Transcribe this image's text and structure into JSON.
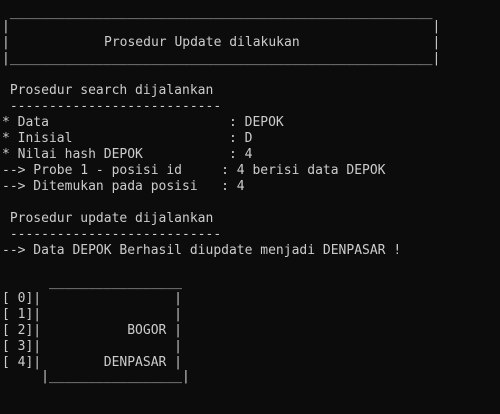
{
  "colors": {
    "background": "#0c0c0c",
    "text": "#cccccc"
  },
  "banner": {
    "top_border": " ______________________________________________________",
    "side_line": "|                                                      |",
    "title": "Prosedur Update dilakukan",
    "bottom_border": "|______________________________________________________|"
  },
  "search": {
    "heading": " Prosedur search dijalankan",
    "rule": " ---------------------------",
    "data_line": "* Data                       : DEPOK",
    "inisial_line": "* Inisial                    : D",
    "hash_line": "* Nilai hash DEPOK           : 4",
    "probe_line": "--> Probe 1 - posisi id     : 4 berisi data DEPOK",
    "found_line": "--> Ditemukan pada posisi   : 4"
  },
  "update": {
    "heading": " Prosedur update dijalankan",
    "rule": " ---------------------------",
    "result_line": "--> Data DEPOK Berhasil diupdate menjadi DENPASAR !"
  },
  "table": {
    "top_border": "      _________________",
    "rows": [
      "[ 0]|                 |",
      "[ 1]|                 |",
      "[ 2]|           BOGOR |",
      "[ 3]|                 |",
      "[ 4]|        DENPASAR |"
    ],
    "bottom_border": "     |_________________|"
  }
}
